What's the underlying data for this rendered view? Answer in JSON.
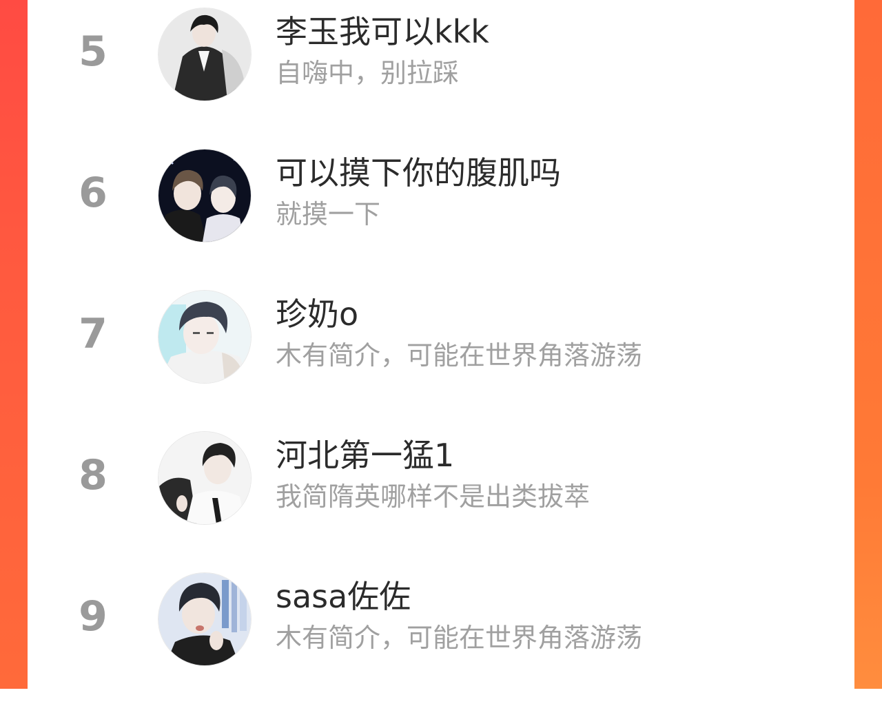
{
  "colors": {
    "left_bar": "#ff4b43",
    "right_bar": "#ff7a36",
    "rank_text": "#9a9a9a",
    "name_text": "#2b2b2b",
    "bio_text": "#a0a0a0"
  },
  "ranking_list": [
    {
      "rank": "5",
      "name": "李玉我可以kkk",
      "bio": "自嗨中，别拉踩",
      "avatar_icon": "anime-avatar-icon"
    },
    {
      "rank": "6",
      "name": "可以摸下你的腹肌吗",
      "bio": "就摸一下",
      "avatar_icon": "anime-avatar-icon"
    },
    {
      "rank": "7",
      "name": "珍奶o",
      "bio": "木有简介，可能在世界角落游荡",
      "avatar_icon": "anime-avatar-icon"
    },
    {
      "rank": "8",
      "name": "河北第一猛1",
      "bio": "我简隋英哪样不是出类拔萃",
      "avatar_icon": "anime-avatar-icon"
    },
    {
      "rank": "9",
      "name": "sasa佐佐",
      "bio": "木有简介，可能在世界角落游荡",
      "avatar_icon": "anime-avatar-icon"
    }
  ]
}
